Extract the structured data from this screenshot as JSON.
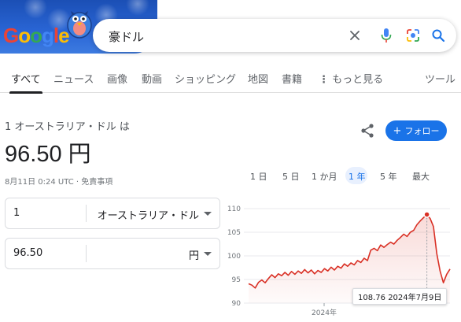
{
  "search": {
    "query": "豪ドル"
  },
  "logo_text": "Google",
  "tabs": [
    {
      "label": "すべて"
    },
    {
      "label": "ニュース"
    },
    {
      "label": "画像"
    },
    {
      "label": "動画"
    },
    {
      "label": "ショッピング"
    },
    {
      "label": "地図"
    },
    {
      "label": "書籍"
    },
    {
      "label": "もっと見る"
    },
    {
      "label": "ツール"
    }
  ],
  "converter": {
    "from_text": "1 オーストラリア・ドル は",
    "rate_text": "96.50 円",
    "date_text": "8月11日 0:24 UTC · 免責事項",
    "follow_label": "フォロー",
    "from_value": "1",
    "from_unit": "オーストラリア・ドル",
    "to_value": "96.50",
    "to_unit": "円"
  },
  "ranges": [
    {
      "label": "1 日"
    },
    {
      "label": "5 日"
    },
    {
      "label": "1 か月"
    },
    {
      "label": "1 年"
    },
    {
      "label": "5 年"
    },
    {
      "label": "最大"
    }
  ],
  "active_range": "1 年",
  "tooltip": {
    "value": "108.76",
    "date": "2024年7月9日"
  },
  "colors": {
    "accent": "#1a73e8",
    "line": "#d93025",
    "fill": "#fce8e6"
  },
  "chart_data": {
    "type": "area",
    "ylim": [
      90,
      110
    ],
    "yticks": [
      90,
      95,
      100,
      105,
      110
    ],
    "xtick_label": "2024年",
    "series": [
      {
        "values": [
          94.1,
          93.8,
          93.2,
          94.4,
          94.9,
          94.3,
          95.2,
          96.0,
          95.4,
          96.2,
          95.8,
          96.5,
          95.9,
          96.7,
          96.1,
          96.8,
          96.3,
          97.1,
          96.4,
          97.0,
          96.2,
          96.9,
          96.5,
          97.3,
          96.8,
          97.6,
          97.0,
          97.8,
          97.4,
          98.3,
          97.8,
          98.5,
          98.1,
          99.0,
          98.6,
          99.5,
          99.0,
          101.2,
          101.6,
          101.1,
          102.3,
          101.8,
          102.4,
          102.9,
          102.5,
          103.3,
          103.9,
          104.6,
          104.1,
          105.0,
          105.4,
          106.6,
          107.4,
          108.1,
          108.76,
          107.9,
          106.2,
          100.5,
          96.8,
          94.3,
          96.1,
          97.2
        ]
      }
    ],
    "highlight": {
      "value": 108.76,
      "label": "2024年7月9日"
    }
  }
}
